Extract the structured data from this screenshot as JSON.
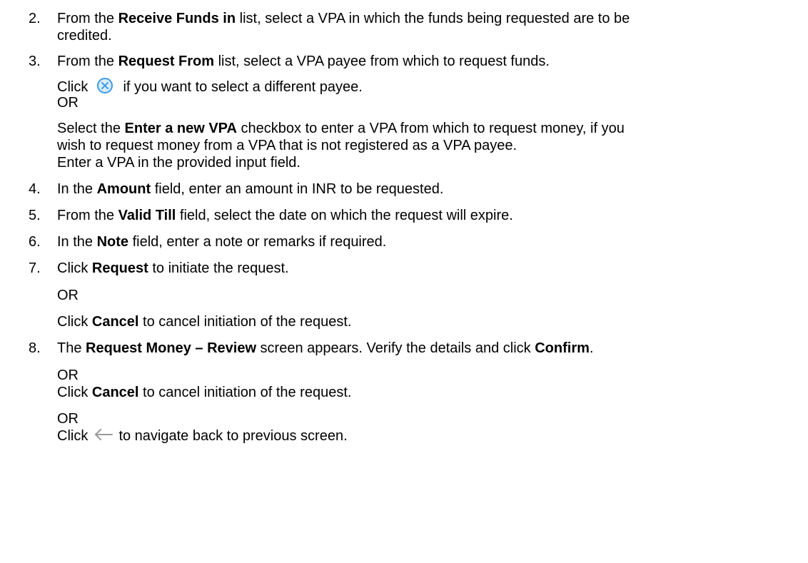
{
  "steps": [
    {
      "num": "2.",
      "pre": "From the ",
      "bold": "Receive Funds in",
      "post_line1": " list, select a VPA in which the funds being requested are to be",
      "line2": "credited."
    },
    {
      "num": "3.",
      "pre": "From the ",
      "bold": "Request From",
      "post": " list, select a VPA payee from which to request funds.",
      "click_pre": "Click ",
      "click_post": " if you want to select a different payee.",
      "or1": "OR",
      "p2_pre": "Select the ",
      "p2_bold": "Enter a new VPA",
      "p2_post_line1": " checkbox to enter a VPA from which to request money, if you",
      "p2_line2": "wish to request money from a VPA that is not registered as a VPA payee.",
      "p2_line3": "Enter a VPA in the provided input field."
    },
    {
      "num": "4.",
      "pre": "In the ",
      "bold": "Amount",
      "post": " field, enter an amount in INR to be requested."
    },
    {
      "num": "5.",
      "pre": "From the ",
      "bold": "Valid Till",
      "post": " field, select the date on which the request will expire."
    },
    {
      "num": "6.",
      "pre": "In the ",
      "bold": "Note",
      "post": " field, enter a note or remarks if required."
    },
    {
      "num": "7.",
      "pre": "Click ",
      "bold": "Request",
      "post": " to initiate the request.",
      "or1": "OR",
      "c_pre": "Click ",
      "c_bold": "Cancel",
      "c_post": " to cancel initiation of the request."
    },
    {
      "num": "8.",
      "pre": "The ",
      "bold": "Request Money – Review",
      "mid": " screen appears. Verify the details and click ",
      "bold2": "Confirm",
      "end": ".",
      "or1": "OR",
      "c_pre": "Click ",
      "c_bold": "Cancel",
      "c_post": " to cancel initiation of the request.",
      "or2": "OR",
      "b_pre": "Click ",
      "b_post": " to navigate back to previous screen."
    }
  ],
  "icons": {
    "cancel_circle": "cancel-circle-icon",
    "back_arrow": "back-arrow-icon"
  },
  "colors": {
    "text": "#000000",
    "cancel_icon": "#3d9be9",
    "back_arrow": "#9a9a9a"
  }
}
